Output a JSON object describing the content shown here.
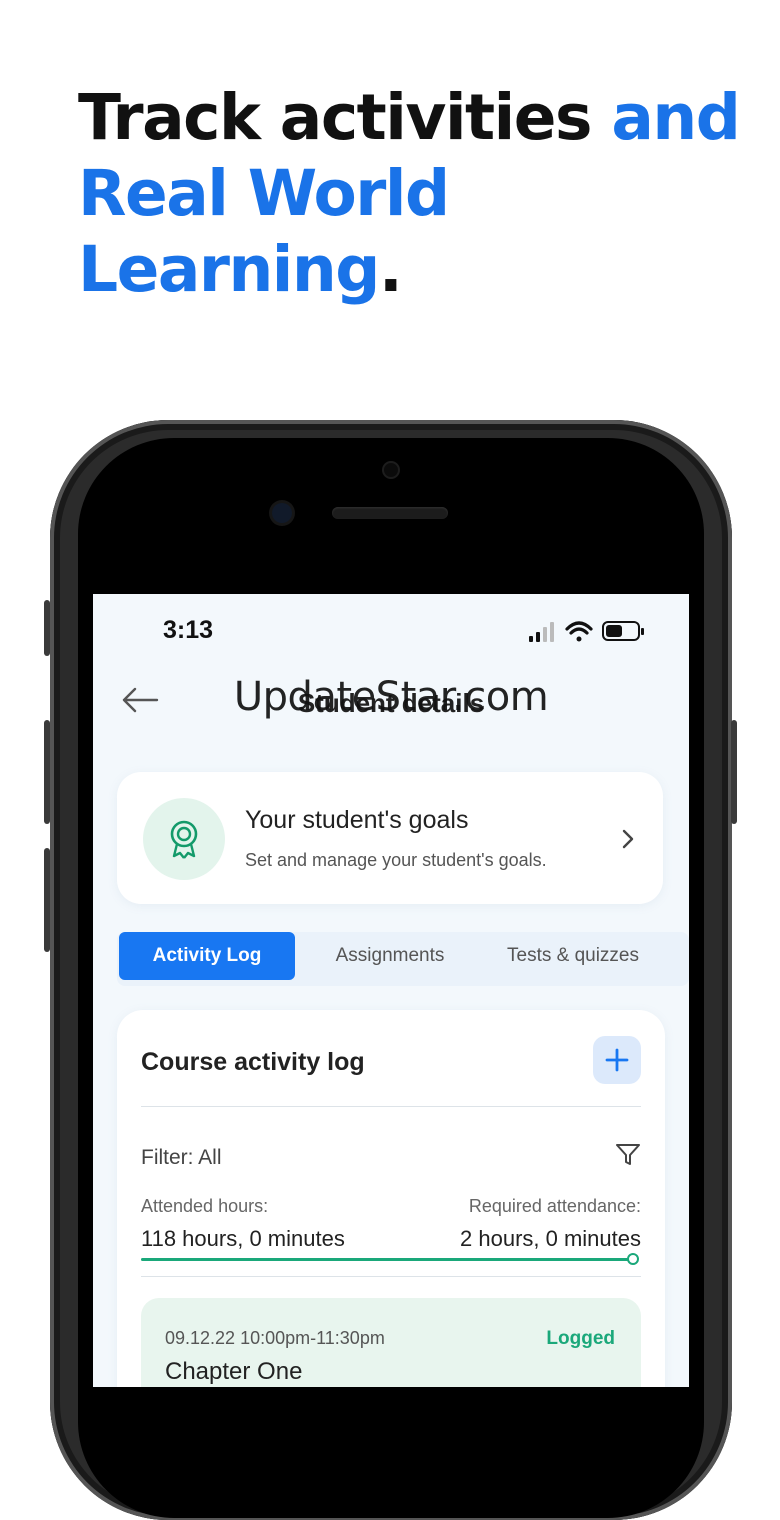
{
  "headline": {
    "line1_dark": "Track activities ",
    "line1_blue": "and",
    "line2_blue": "Real World Learning",
    "line2_dark": "."
  },
  "colors": {
    "brand_blue": "#1a73e8",
    "tab_active": "#1877f2",
    "success_green": "#1aa87a"
  },
  "status_bar": {
    "time": "3:13",
    "icons": [
      "signal-icon",
      "wifi-icon",
      "battery-icon"
    ]
  },
  "header": {
    "title": "Student details",
    "back_icon": "arrow-left-icon"
  },
  "watermark": "UpdateStar.com",
  "goals": {
    "icon": "award-ribbon-icon",
    "title": "Your student's goals",
    "subtitle": "Set and manage your student's goals."
  },
  "tabs": [
    {
      "label": "Activity Log",
      "active": true
    },
    {
      "label": "Assignments",
      "active": false
    },
    {
      "label": "Tests & quizzes",
      "active": false
    }
  ],
  "activity_log": {
    "title": "Course activity log",
    "add_icon": "plus-icon",
    "filter_label": "Filter: All",
    "filter_icon": "filter-funnel-icon",
    "attended_label": "Attended hours:",
    "attended_value": "118 hours, 0 minutes",
    "required_label": "Required attendance:",
    "required_value": "2 hours, 0 minutes",
    "progress_fraction": 1.0,
    "entry": {
      "datetime": "09.12.22 10:00pm-11:30pm",
      "status": "Logged",
      "title": "Chapter One"
    }
  }
}
